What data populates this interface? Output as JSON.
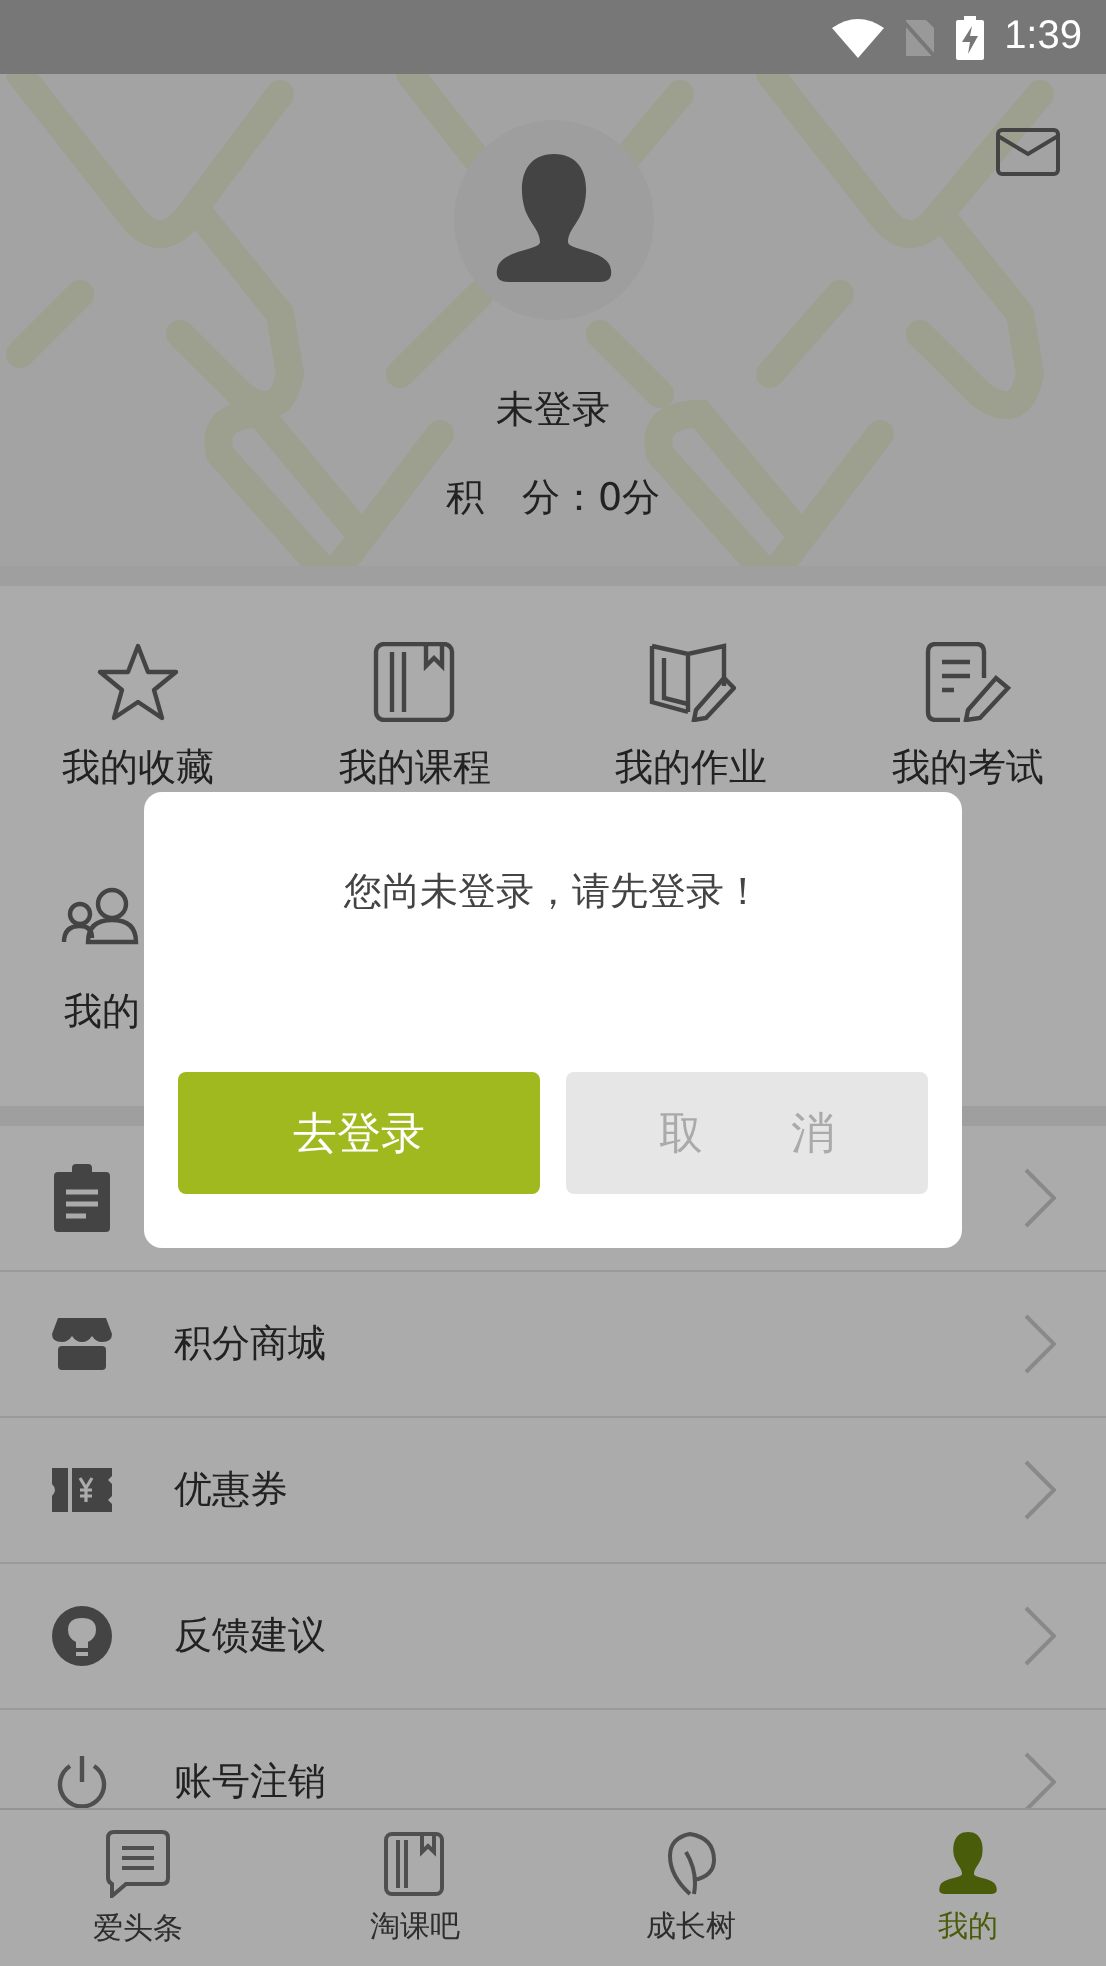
{
  "status_bar": {
    "time": "1:39"
  },
  "profile": {
    "name": "未登录",
    "points": "积　分：0分"
  },
  "shortcuts": [
    {
      "label": "我的收藏",
      "kind": "star"
    },
    {
      "label": "我的课程",
      "kind": "book"
    },
    {
      "label": "我的作业",
      "kind": "homework"
    },
    {
      "label": "我的考试",
      "kind": "exam"
    },
    {
      "label": "我的",
      "kind": "group"
    }
  ],
  "menu": [
    {
      "kind": "clipboard"
    },
    {
      "label": "积分商城",
      "kind": "shop"
    },
    {
      "label": "优惠券",
      "kind": "coupon"
    },
    {
      "label": "反馈建议",
      "kind": "bulb"
    },
    {
      "label": "账号注销",
      "kind": "power"
    }
  ],
  "dialog": {
    "message": "您尚未登录，请先登录！",
    "confirm": "去登录",
    "cancel": "取　　消"
  },
  "tabs": [
    {
      "label": "爱头条",
      "kind": "news",
      "selected": false
    },
    {
      "label": "淘课吧",
      "kind": "book",
      "selected": false
    },
    {
      "label": "成长树",
      "kind": "leaf",
      "selected": false
    },
    {
      "label": "我的",
      "kind": "person",
      "selected": true
    }
  ]
}
